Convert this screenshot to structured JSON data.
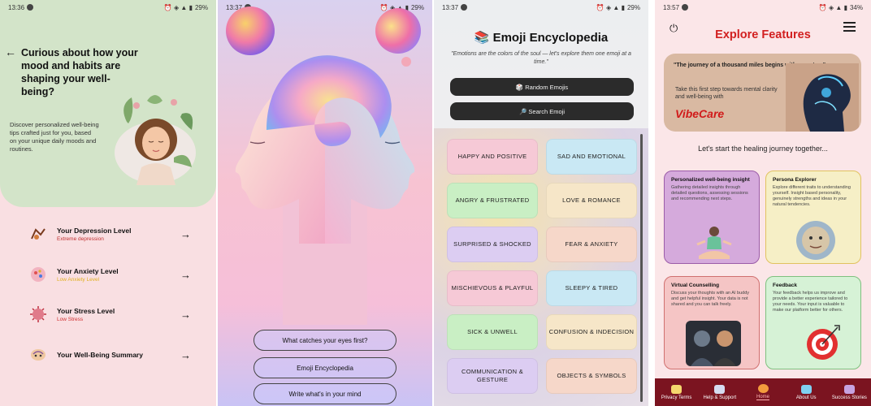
{
  "screen1": {
    "status_time": "13:36",
    "status_battery": "29%",
    "heading": "Curious about how your mood and habits are shaping your well-being?",
    "description": "Discover personalized well-being tips crafted just for you, based on your unique daily moods and routines.",
    "cards": [
      {
        "title": "Your Depression Level",
        "subtitle": "Extreme depression",
        "color": "#f6c3cc",
        "subcolor": "#c03030",
        "icon": "depression-icon"
      },
      {
        "title": "Your Anxiety Level",
        "subtitle": "Low Anxiety Level",
        "color": "#c7efc7",
        "subcolor": "#e0b020",
        "icon": "anxiety-icon"
      },
      {
        "title": "Your Stress Level",
        "subtitle": "Low Stress",
        "color": "#d5b1e4",
        "subcolor": "#d03030",
        "icon": "stress-icon"
      },
      {
        "title": "Your Well-Being Summary",
        "subtitle": "",
        "color": "#d77e7e",
        "subcolor": "#222222",
        "icon": "wellbeing-icon"
      }
    ]
  },
  "screen2": {
    "status_time": "13:37",
    "status_battery": "29%",
    "buttons": [
      {
        "label": "What catches your eyes first?"
      },
      {
        "label": "Emoji Encyclopedia"
      },
      {
        "label": "Write what's in your mind"
      }
    ]
  },
  "screen3": {
    "status_time": "13:37",
    "status_battery": "29%",
    "title": "📚 Emoji Encyclopedia",
    "quote": "\"Emotions are the colors of the soul — let's explore them one emoji at a time.\"",
    "random_btn": "🎲 Random Emojis",
    "search_btn": "🔎 Search Emoji",
    "categories": [
      {
        "label": "HAPPY AND POSITIVE",
        "color": "#f6c9d6"
      },
      {
        "label": "SAD AND EMOTIONAL",
        "color": "#c9e8f4"
      },
      {
        "label": "ANGRY & FRUSTRATED",
        "color": "#c9efc4"
      },
      {
        "label": "LOVE & ROMANCE",
        "color": "#f6e6c8"
      },
      {
        "label": "SURPRISED & SHOCKED",
        "color": "#dccdf2"
      },
      {
        "label": "FEAR & ANXIETY",
        "color": "#f6d7c9"
      },
      {
        "label": "MISCHIEVOUS & PLAYFUL",
        "color": "#f6c9d6"
      },
      {
        "label": "SLEEPY & TIRED",
        "color": "#c9e8f4"
      },
      {
        "label": "SICK & UNWELL",
        "color": "#c9efc4"
      },
      {
        "label": "CONFUSION & INDECISION",
        "color": "#f6e6c8"
      },
      {
        "label": "COMMUNICATION & GESTURE",
        "color": "#dccdf2"
      },
      {
        "label": "OBJECTS & SYMBOLS",
        "color": "#f6d7c9"
      }
    ]
  },
  "screen4": {
    "status_time": "13:57",
    "status_battery": "34%",
    "title": "Explore Features",
    "banner_quote": "\"The journey of a thousand miles begins with one step.\"",
    "banner_text": "Take this first step towards mental clarity and well-being with",
    "banner_brand": "VibeCare",
    "subtitle": "Let's start the healing journey together...",
    "cards": [
      {
        "title": "Personalized well-being insight",
        "desc": "Gathering detailed insights through detailed questions, assessing sessions and recommending next steps.",
        "color": "#d5aadc",
        "border": "#9b5ca8"
      },
      {
        "title": "Persona Explorer",
        "desc": "Explore different traits to understanding yourself. Insight based personality, genuinely strengths and ideas in your natural tendencies.",
        "color": "#f6efc6",
        "border": "#e1c260"
      },
      {
        "title": "Virtual Counselling",
        "desc": "Discuss your thoughts with an AI buddy and get helpful insight. Your data is not shared and you can talk freely.",
        "color": "#f5c5c5",
        "border": "#d07070"
      },
      {
        "title": "Feedback",
        "desc": "Your feedback helps us improve and provide a better experience tailored to your needs. Your input is valuable to make our platform better for others.",
        "color": "#d6f2d6",
        "border": "#7fc07f"
      }
    ],
    "nav": [
      {
        "label": "Privacy Terms",
        "icon": "privacy-icon",
        "color": "#f5d76e"
      },
      {
        "label": "Help & Support",
        "icon": "help-icon",
        "color": "#d5dcf0"
      },
      {
        "label": "Home",
        "icon": "home-icon",
        "color": "#f39c3d"
      },
      {
        "label": "About Us",
        "icon": "about-icon",
        "color": "#7fd0f0"
      },
      {
        "label": "Success Stories",
        "icon": "stories-icon",
        "color": "#c7a3e0"
      }
    ]
  }
}
